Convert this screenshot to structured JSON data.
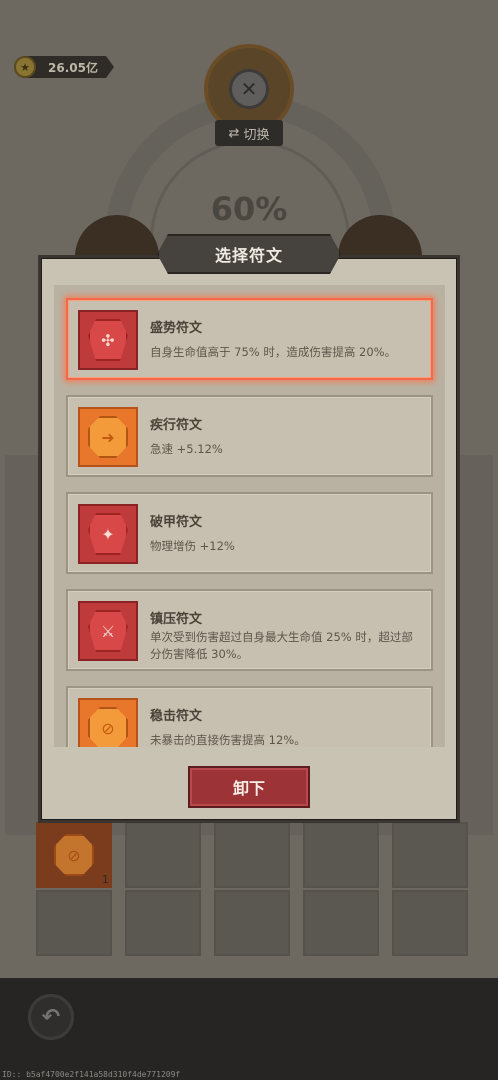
{
  "header": {
    "currency_value": "26.05亿",
    "switch_label": "切换",
    "progress_label": "60%"
  },
  "modal": {
    "title": "选择符文",
    "runes": [
      {
        "name": "盛势符文",
        "desc": "自身生命值高于 75% 时，造成伤害提高 20%。",
        "color": "#bf3b3b",
        "selected": true
      },
      {
        "name": "疾行符文",
        "desc": "急速 +5.12%",
        "color": "#e8772b",
        "selected": false
      },
      {
        "name": "破甲符文",
        "desc": "物理增伤 +12%",
        "color": "#bf3b3b",
        "selected": false
      },
      {
        "name": "镇压符文",
        "desc": "单次受到伤害超过自身最大生命值 25% 时，超过部分伤害降低 30%。",
        "color": "#bf3b3b",
        "selected": false
      },
      {
        "name": "稳击符文",
        "desc": "未暴击的直接伤害提高 12%。",
        "color": "#e8772b",
        "selected": false
      }
    ],
    "unload_label": "卸下"
  },
  "inventory": {
    "owned_count": "1"
  },
  "footer": {
    "id_text": "ID:: b5af4700e2f141a58d310f4de771209f"
  }
}
